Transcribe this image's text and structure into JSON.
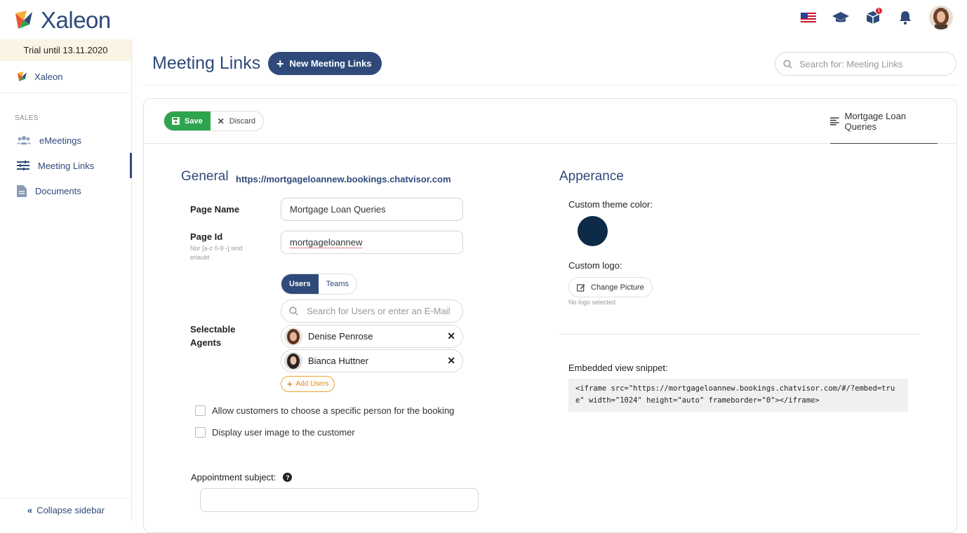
{
  "app": {
    "name": "Xaleon"
  },
  "topbar": {
    "icons": [
      "us-flag-icon",
      "graduation-cap-icon",
      "package-icon",
      "bell-icon"
    ],
    "notification_badge": "1"
  },
  "sidebar": {
    "trial": "Trial until 13.11.2020",
    "org_name": "Xaleon",
    "section": "SALES",
    "items": [
      {
        "label": "eMeetings",
        "icon": "users-icon"
      },
      {
        "label": "Meeting Links",
        "icon": "sliders-icon"
      },
      {
        "label": "Documents",
        "icon": "document-icon"
      }
    ],
    "collapse_label": "Collapse sidebar"
  },
  "header": {
    "title": "Meeting Links",
    "new_button": "New Meeting Links",
    "search_placeholder": "Search for: Meeting Links"
  },
  "toolbar": {
    "save_label": "Save",
    "discard_label": "Discard",
    "doc_tab": "Mortgage Loan Queries"
  },
  "general": {
    "heading": "General",
    "url": "https://mortgageloannew.bookings.chatvisor.com",
    "page_name_label": "Page Name",
    "page_name_value": "Mortgage Loan Queries",
    "page_id_label": "Page Id",
    "page_id_hint": "Nur [a-z 0-9 -] sind erlaubt",
    "page_id_value": "mortgageloannew",
    "tabs": [
      "Users",
      "Teams"
    ],
    "agents_label": "Selectable Agents",
    "user_search_placeholder": "Search for Users or enter an E-Mail",
    "agents": [
      "Denise Penrose",
      "Bianca Huttner"
    ],
    "add_users_label": "Add Users",
    "checkbox_choose_person": "Allow customers to choose a specific person for the booking",
    "checkbox_display_image": "Display user image to the customer",
    "appointment_subject_label": "Appointment subject:",
    "appointment_subject_value": ""
  },
  "appearance": {
    "heading": "Apperance",
    "theme_color_label": "Custom theme color:",
    "theme_color": "#0d2a47",
    "logo_label": "Custom logo:",
    "change_picture_label": "Change Picture",
    "no_logo_text": "No logo selected",
    "snippet_label": "Embedded view snippet:",
    "snippet_code": "<iframe src=\"https://mortgageloannew.bookings.chatvisor.com/#/?embed=true\" width=\"1024\" height=\"auto\" frameborder=\"0\"></iframe>"
  },
  "colors": {
    "primary": "#2f4a7a",
    "save_green": "#2ea44f",
    "accent_orange": "#e58a0a"
  }
}
